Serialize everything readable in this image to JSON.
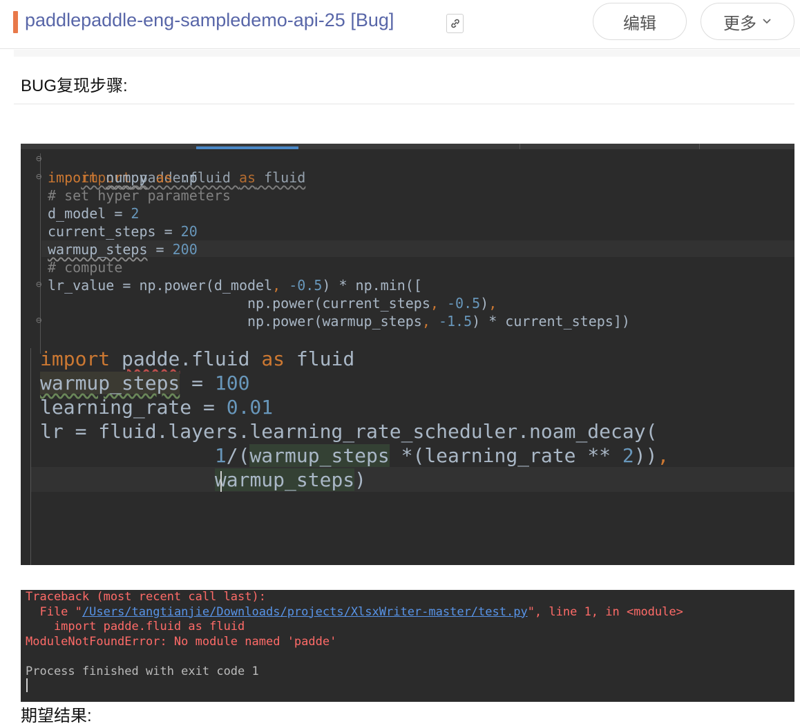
{
  "header": {
    "title": "paddlepaddle-eng-sampledemo-api-25 [Bug]",
    "edit_label": "编辑",
    "more_label": "更多",
    "link_icon": "link-icon",
    "more_icon": "chevron-down-icon",
    "accent_color": "#e8794a",
    "title_color": "#5866a8"
  },
  "section": {
    "heading": "BUG复现步骤:"
  },
  "editor_small": {
    "lines": [
      "import padde.fluid as fluid",
      "import numpy as np",
      "# set hyper parameters",
      "d_model = 2",
      "current_steps = 20",
      "warmup_steps = 200",
      "# compute",
      "lr_value = np.power(d_model, -0.5) * np.min([",
      "                        np.power(current_steps, -0.5),",
      "                        np.power(warmup_steps, -1.5) * current_steps])"
    ]
  },
  "editor_large": {
    "lines": [
      "import padde.fluid as fluid",
      "warmup_steps = 100",
      "learning_rate = 0.01",
      "lr = fluid.layers.learning_rate_scheduler.noam_decay(",
      "               1/(warmup_steps *(learning_rate ** 2)),",
      "               warmup_steps)"
    ]
  },
  "console": {
    "traceback": "Traceback (most recent call last):",
    "file_prefix": "  File \"",
    "file_path": "/Users/tangtianjie/Downloads/projects/XlsxWriter-master/test.py",
    "file_suffix": "\", line 1, in <module>",
    "source_line": "    import padde.fluid as fluid",
    "error": "ModuleNotFoundError: No module named 'padde'",
    "exit": "Process finished with exit code 1"
  },
  "next_heading": "期望结果:"
}
